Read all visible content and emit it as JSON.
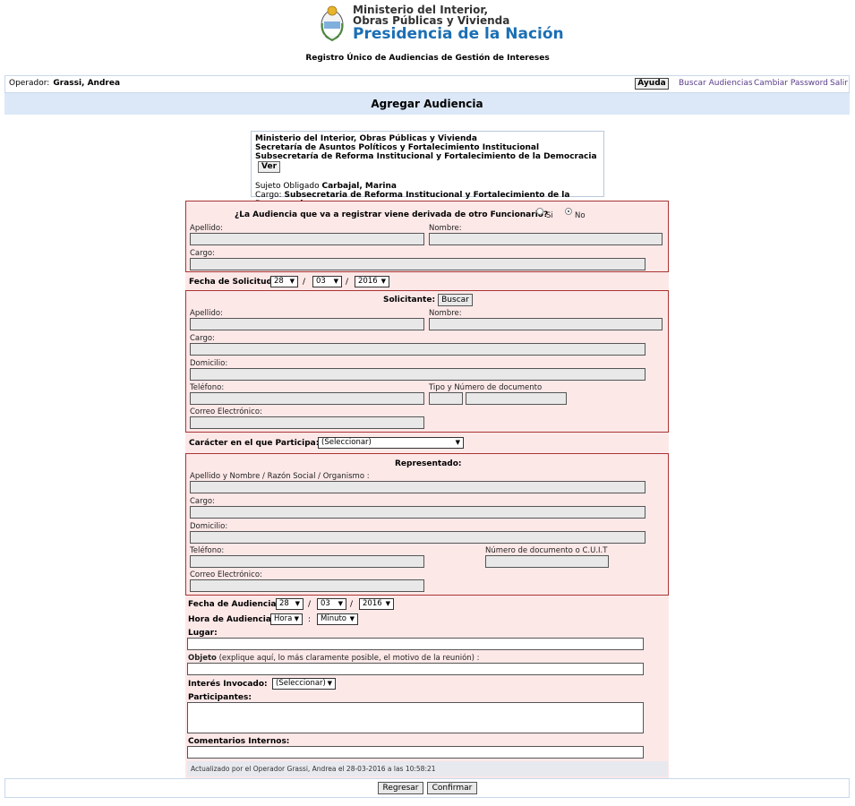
{
  "header": {
    "ministry_line1": "Ministerio del Interior,",
    "ministry_line2": "Obras Públicas y Vivienda",
    "presidency": "Presidencia de la Nación",
    "registry_title": "Registro Único de Audiencias de Gestión de Intereses"
  },
  "operator": {
    "label": "Operador:",
    "name": "Grassi, Andrea"
  },
  "nav": {
    "help": "Ayuda",
    "search": "Buscar Audiencias",
    "change_password": "Cambiar Password",
    "logout": "Salir"
  },
  "page_title": "Agregar Audiencia",
  "info": {
    "line1": "Ministerio del Interior, Obras Públicas y Vivienda",
    "line2": "Secretaría de Asuntos Políticos y Fortalecimiento Institucional",
    "line3": "Subsecretaría de Reforma Institucional y Fortalecimiento de la Democracia",
    "ver_button": "Ver",
    "subject_label": "Sujeto Obligado",
    "subject_name": "Carbajal, Marina",
    "cargo_label": "Cargo:",
    "cargo_value": "Subsecretaria de Reforma Institucional y Fortalecimiento de la Democracia"
  },
  "derived": {
    "question": "¿La Audiencia que va a registrar viene derivada de otro Funcionario?",
    "opt_yes": "Si",
    "opt_no": "No",
    "selected": "No",
    "apellido": "Apellido:",
    "nombre": "Nombre:",
    "cargo": "Cargo:"
  },
  "fecha_solicitud": {
    "label": "Fecha de Solicitud:",
    "day": "28",
    "month": "03",
    "year": "2016"
  },
  "solicitante": {
    "title": "Solicitante:",
    "buscar": "Buscar",
    "apellido": "Apellido:",
    "nombre": "Nombre:",
    "cargo": "Cargo:",
    "domicilio": "Domicilio:",
    "telefono": "Teléfono:",
    "documento": "Tipo y Número de documento",
    "correo": "Correo Electrónico:"
  },
  "caracter": {
    "label": "Carácter en el que Participa:",
    "value": "(Seleccionar)"
  },
  "representado": {
    "title": "Representado:",
    "nombre": "Apellido y Nombre / Razón Social / Organismo :",
    "cargo": "Cargo:",
    "domicilio": "Domicilio:",
    "telefono": "Teléfono:",
    "documento": "Número de documento o C.U.I.T",
    "correo": "Correo Electrónico:"
  },
  "fecha_audiencia": {
    "label": "Fecha de Audiencia:",
    "day": "28",
    "month": "03",
    "year": "2016"
  },
  "hora_audiencia": {
    "label": "Hora de Audiencia:",
    "hour": "Hora",
    "minute": "Minuto"
  },
  "lugar": {
    "label": "Lugar:"
  },
  "objeto": {
    "label": "Objeto",
    "hint": "(explique aquí, lo más claramente posible, el motivo de la reunión) :"
  },
  "interes": {
    "label": "Interés Invocado:",
    "value": "(Seleccionar)"
  },
  "participantes": {
    "label": "Participantes:"
  },
  "comentarios": {
    "label": "Comentarios Internos:"
  },
  "updated": "Actualizado por el Operador Grassi, Andrea el 28-03-2016 a las 10:58:21",
  "footer": {
    "back": "Regresar",
    "confirm": "Confirmar"
  },
  "colors": {
    "accent_blue": "#1b6fb5",
    "pink_bg": "#fde8e8",
    "border_red": "#a33333",
    "title_bar": "#dce8f7"
  }
}
